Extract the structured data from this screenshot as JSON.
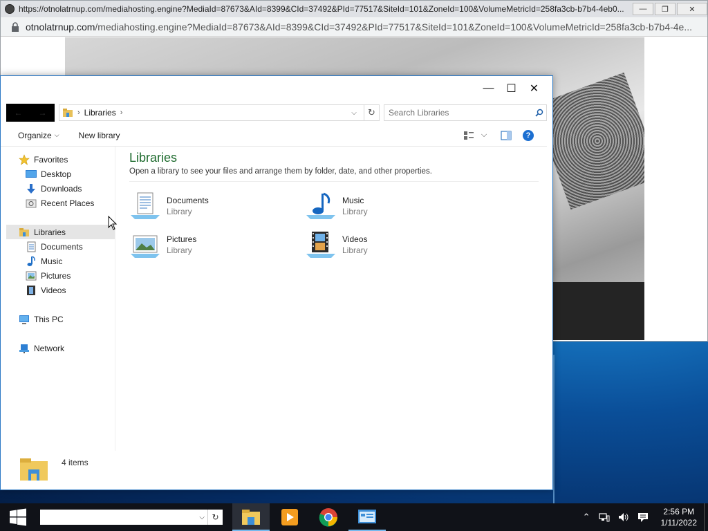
{
  "browser": {
    "title": "https://otnolatrnup.com/mediahosting.engine?MediaId=87673&AId=8399&CId=37492&PId=77517&SiteId=101&ZoneId=100&VolumeMetricId=258fa3cb-b7b4-4eb0...",
    "url_host": "otnolatrnup.com",
    "url_path": "/mediahosting.engine?MediaId=87673&AId=8399&CId=37492&PId=77517&SiteId=101&ZoneId=100&VolumeMetricId=258fa3cb-b7b4-4e..."
  },
  "explorer": {
    "breadcrumb": [
      "Libraries"
    ],
    "search_placeholder": "Search Libraries",
    "toolbar": {
      "organize": "Organize",
      "new_library": "New library"
    },
    "nav": {
      "favorites": "Favorites",
      "desktop": "Desktop",
      "downloads": "Downloads",
      "recent_places": "Recent Places",
      "libraries": "Libraries",
      "documents": "Documents",
      "music": "Music",
      "pictures": "Pictures",
      "videos": "Videos",
      "this_pc": "This PC",
      "network": "Network"
    },
    "content": {
      "title": "Libraries",
      "subtitle": "Open a library to see your files and arrange them by folder, date, and other properties.",
      "libraries": [
        {
          "name": "Documents",
          "type": "Library",
          "icon": "documents-library-icon"
        },
        {
          "name": "Music",
          "type": "Library",
          "icon": "music-library-icon"
        },
        {
          "name": "Pictures",
          "type": "Library",
          "icon": "pictures-library-icon"
        },
        {
          "name": "Videos",
          "type": "Library",
          "icon": "videos-library-icon"
        }
      ]
    },
    "status": "4 items"
  },
  "taskbar": {
    "apps": [
      "file-explorer",
      "media-player",
      "chrome",
      "control-panel"
    ],
    "time": "2:56 PM",
    "date": "1/11/2022"
  },
  "colors": {
    "accent": "#1e6b2e",
    "window_border": "#2b78c5",
    "taskbar": "#101218"
  }
}
